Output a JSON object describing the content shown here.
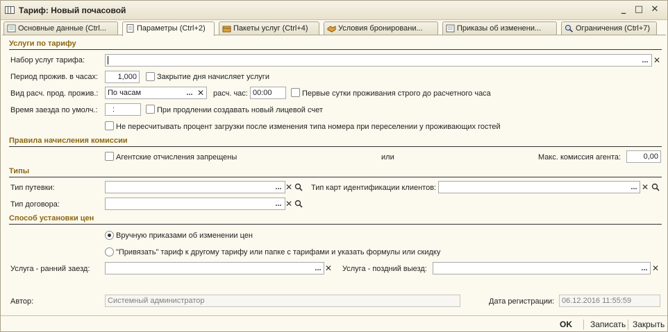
{
  "window": {
    "title": "Тариф: Новый почасовой"
  },
  "tabs": [
    {
      "label": "Основные данные (Ctrl..."
    },
    {
      "label": "Параметры (Ctrl+2)"
    },
    {
      "label": "Пакеты услуг (Ctrl+4)"
    },
    {
      "label": "Условия бронировани..."
    },
    {
      "label": "Приказы об изменени..."
    },
    {
      "label": "Ограничения (Ctrl+7)"
    }
  ],
  "services": {
    "title": "Услуги по тарифу",
    "set_label": "Набор услуг тарифа:",
    "set_value": "",
    "period_label": "Период прожив. в часах:",
    "period_value": "1,000",
    "close_day_label": "Закрытие дня начисляет услуги",
    "calc_type_label": "Вид расч. прод. прожив.:",
    "calc_type_value": "По часам",
    "calc_hour_label": "расч. час:",
    "calc_hour_value": "00:00",
    "first_day_label": "Первые сутки проживания строго до расчетного часа",
    "checkin_label": "Время заезда по умолч.:",
    "checkin_value": ":",
    "new_account_label": "При продлении создавать новый лицевой счет",
    "no_recalc_label": "Не пересчитывать процент загрузки после изменения типа номера при переселении у проживающих гостей"
  },
  "commission": {
    "title": "Правила начисления комиссии",
    "agent_forbidden_label": "Агентские отчисления запрещены",
    "or_label": "или",
    "max_label": "Макс. комиссия агента:",
    "max_value": "0,00"
  },
  "types": {
    "title": "Типы",
    "voucher_label": "Тип путевки:",
    "voucher_value": "",
    "card_label": "Тип карт идентификации клиентов:",
    "card_value": "",
    "contract_label": "Тип договора:",
    "contract_value": ""
  },
  "pricing": {
    "title": "Способ установки цен",
    "manual_label": "Вручную приказами об изменении цен",
    "bind_label": "\"Привязать\" тариф к другому тарифу или папке с тарифами и указать формулы или скидку",
    "early_label": "Услуга - ранний заезд:",
    "early_value": "",
    "late_label": "Услуга - поздний выезд:",
    "late_value": ""
  },
  "footer": {
    "author_label": "Автор:",
    "author_value": "Системный администратор",
    "reg_date_label": "Дата регистрации:",
    "reg_date_value": "06.12.2016 11:55:59"
  },
  "buttons": {
    "ok": "OK",
    "save": "Записать",
    "close": "Закрыть"
  }
}
